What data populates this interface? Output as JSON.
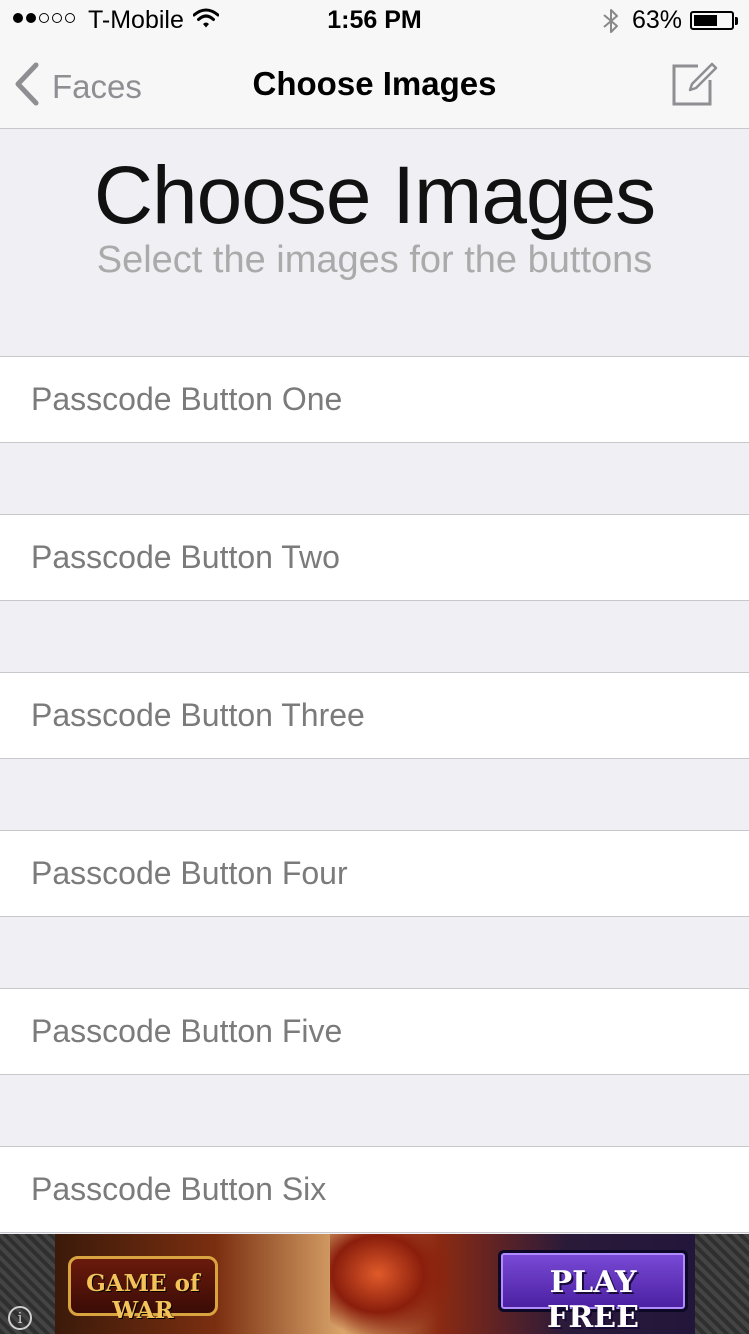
{
  "status_bar": {
    "carrier": "T-Mobile",
    "time": "1:56 PM",
    "battery_percent_text": "63%",
    "battery_level": 0.63,
    "signal_bars_filled": 2,
    "signal_bars_total": 5
  },
  "nav": {
    "back_label": "Faces",
    "title": "Choose Images",
    "right_icon": "compose-icon"
  },
  "header": {
    "title": "Choose Images",
    "subtitle": "Select the images for the buttons"
  },
  "list": {
    "items": [
      {
        "label": "Passcode Button One"
      },
      {
        "label": "Passcode Button Two"
      },
      {
        "label": "Passcode Button Three"
      },
      {
        "label": "Passcode Button Four"
      },
      {
        "label": "Passcode Button Five"
      },
      {
        "label": "Passcode Button Six"
      }
    ]
  },
  "ad": {
    "logo_text": "GAME of WAR",
    "cta_text": "PLAY FREE",
    "info_icon": "info-icon"
  },
  "colors": {
    "background": "#efeff4",
    "cell_text": "#7b7b7b",
    "separator": "#c8c7cc",
    "ad_button": "#5a2bc0"
  }
}
